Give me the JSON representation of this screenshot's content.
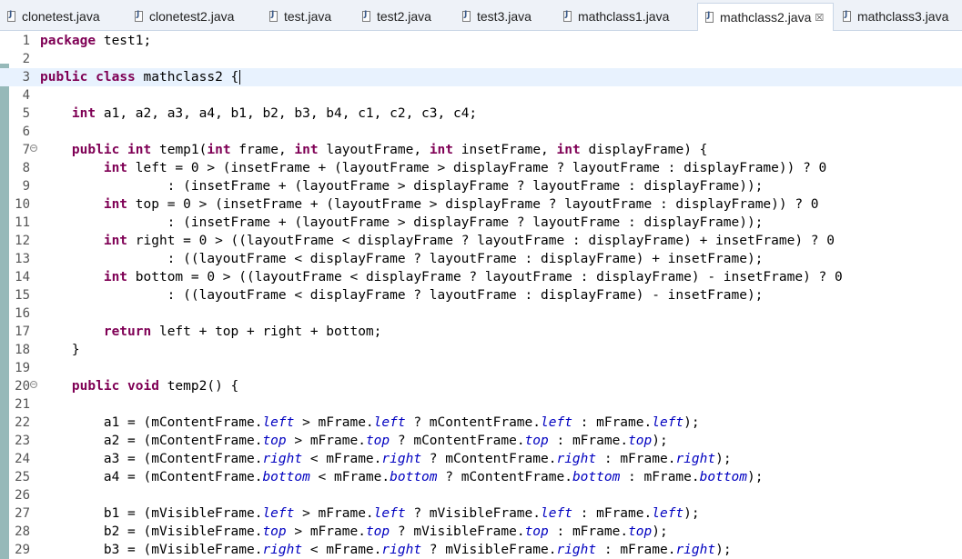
{
  "tabs": [
    {
      "label": "clonetest.java",
      "active": false
    },
    {
      "label": "clonetest2.java",
      "active": false
    },
    {
      "label": "test.java",
      "active": false
    },
    {
      "label": "test2.java",
      "active": false
    },
    {
      "label": "test3.java",
      "active": false
    },
    {
      "label": "mathclass1.java",
      "active": false
    },
    {
      "label": "mathclass2.java",
      "active": true,
      "close": "☒"
    },
    {
      "label": "mathclass3.java",
      "active": false
    }
  ],
  "editor": {
    "current_line": 3,
    "lines": [
      {
        "n": "1",
        "segs": [
          [
            "kw",
            "package"
          ],
          [
            "t",
            " test1;"
          ]
        ]
      },
      {
        "n": "2",
        "segs": []
      },
      {
        "n": "3",
        "segs": [
          [
            "kw",
            "public"
          ],
          [
            "t",
            " "
          ],
          [
            "kw",
            "class"
          ],
          [
            "t",
            " mathclass2 {"
          ]
        ]
      },
      {
        "n": "4",
        "segs": []
      },
      {
        "n": "5",
        "segs": [
          [
            "t",
            "    "
          ],
          [
            "kw",
            "int"
          ],
          [
            "t",
            " a1, a2, a3, a4, b1, b2, b3, b4, c1, c2, c3, c4;"
          ]
        ]
      },
      {
        "n": "6",
        "segs": []
      },
      {
        "n": "7",
        "fold": "⊖",
        "segs": [
          [
            "t",
            "    "
          ],
          [
            "kw",
            "public"
          ],
          [
            "t",
            " "
          ],
          [
            "kw",
            "int"
          ],
          [
            "t",
            " temp1("
          ],
          [
            "kw",
            "int"
          ],
          [
            "t",
            " frame, "
          ],
          [
            "kw",
            "int"
          ],
          [
            "t",
            " layoutFrame, "
          ],
          [
            "kw",
            "int"
          ],
          [
            "t",
            " insetFrame, "
          ],
          [
            "kw",
            "int"
          ],
          [
            "t",
            " displayFrame) {"
          ]
        ]
      },
      {
        "n": "8",
        "segs": [
          [
            "t",
            "        "
          ],
          [
            "kw",
            "int"
          ],
          [
            "t",
            " left = 0 > (insetFrame + (layoutFrame > displayFrame ? layoutFrame : displayFrame)) ? 0"
          ]
        ]
      },
      {
        "n": "9",
        "segs": [
          [
            "t",
            "                : (insetFrame + (layoutFrame > displayFrame ? layoutFrame : displayFrame));"
          ]
        ]
      },
      {
        "n": "10",
        "segs": [
          [
            "t",
            "        "
          ],
          [
            "kw",
            "int"
          ],
          [
            "t",
            " top = 0 > (insetFrame + (layoutFrame > displayFrame ? layoutFrame : displayFrame)) ? 0"
          ]
        ]
      },
      {
        "n": "11",
        "segs": [
          [
            "t",
            "                : (insetFrame + (layoutFrame > displayFrame ? layoutFrame : displayFrame));"
          ]
        ]
      },
      {
        "n": "12",
        "segs": [
          [
            "t",
            "        "
          ],
          [
            "kw",
            "int"
          ],
          [
            "t",
            " right = 0 > ((layoutFrame < displayFrame ? layoutFrame : displayFrame) + insetFrame) ? 0"
          ]
        ]
      },
      {
        "n": "13",
        "segs": [
          [
            "t",
            "                : ((layoutFrame < displayFrame ? layoutFrame : displayFrame) + insetFrame);"
          ]
        ]
      },
      {
        "n": "14",
        "segs": [
          [
            "t",
            "        "
          ],
          [
            "kw",
            "int"
          ],
          [
            "t",
            " bottom = 0 > ((layoutFrame < displayFrame ? layoutFrame : displayFrame) - insetFrame) ? 0"
          ]
        ]
      },
      {
        "n": "15",
        "segs": [
          [
            "t",
            "                : ((layoutFrame < displayFrame ? layoutFrame : displayFrame) - insetFrame);"
          ]
        ]
      },
      {
        "n": "16",
        "segs": []
      },
      {
        "n": "17",
        "segs": [
          [
            "t",
            "        "
          ],
          [
            "kw",
            "return"
          ],
          [
            "t",
            " left + top + right + bottom;"
          ]
        ]
      },
      {
        "n": "18",
        "segs": [
          [
            "t",
            "    }"
          ]
        ]
      },
      {
        "n": "19",
        "segs": []
      },
      {
        "n": "20",
        "fold": "⊖",
        "segs": [
          [
            "t",
            "    "
          ],
          [
            "kw",
            "public"
          ],
          [
            "t",
            " "
          ],
          [
            "kw",
            "void"
          ],
          [
            "t",
            " temp2() {"
          ]
        ]
      },
      {
        "n": "21",
        "segs": []
      },
      {
        "n": "22",
        "segs": [
          [
            "t",
            "        a1 = (mContentFrame."
          ],
          [
            "fld",
            "left"
          ],
          [
            "t",
            " > mFrame."
          ],
          [
            "fld",
            "left"
          ],
          [
            "t",
            " ? mContentFrame."
          ],
          [
            "fld",
            "left"
          ],
          [
            "t",
            " : mFrame."
          ],
          [
            "fld",
            "left"
          ],
          [
            "t",
            ");"
          ]
        ]
      },
      {
        "n": "23",
        "segs": [
          [
            "t",
            "        a2 = (mContentFrame."
          ],
          [
            "fld",
            "top"
          ],
          [
            "t",
            " > mFrame."
          ],
          [
            "fld",
            "top"
          ],
          [
            "t",
            " ? mContentFrame."
          ],
          [
            "fld",
            "top"
          ],
          [
            "t",
            " : mFrame."
          ],
          [
            "fld",
            "top"
          ],
          [
            "t",
            ");"
          ]
        ]
      },
      {
        "n": "24",
        "segs": [
          [
            "t",
            "        a3 = (mContentFrame."
          ],
          [
            "fld",
            "right"
          ],
          [
            "t",
            " < mFrame."
          ],
          [
            "fld",
            "right"
          ],
          [
            "t",
            " ? mContentFrame."
          ],
          [
            "fld",
            "right"
          ],
          [
            "t",
            " : mFrame."
          ],
          [
            "fld",
            "right"
          ],
          [
            "t",
            ");"
          ]
        ]
      },
      {
        "n": "25",
        "segs": [
          [
            "t",
            "        a4 = (mContentFrame."
          ],
          [
            "fld",
            "bottom"
          ],
          [
            "t",
            " < mFrame."
          ],
          [
            "fld",
            "bottom"
          ],
          [
            "t",
            " ? mContentFrame."
          ],
          [
            "fld",
            "bottom"
          ],
          [
            "t",
            " : mFrame."
          ],
          [
            "fld",
            "bottom"
          ],
          [
            "t",
            ");"
          ]
        ]
      },
      {
        "n": "26",
        "segs": []
      },
      {
        "n": "27",
        "segs": [
          [
            "t",
            "        b1 = (mVisibleFrame."
          ],
          [
            "fld",
            "left"
          ],
          [
            "t",
            " > mFrame."
          ],
          [
            "fld",
            "left"
          ],
          [
            "t",
            " ? mVisibleFrame."
          ],
          [
            "fld",
            "left"
          ],
          [
            "t",
            " : mFrame."
          ],
          [
            "fld",
            "left"
          ],
          [
            "t",
            ");"
          ]
        ]
      },
      {
        "n": "28",
        "segs": [
          [
            "t",
            "        b2 = (mVisibleFrame."
          ],
          [
            "fld",
            "top"
          ],
          [
            "t",
            " > mFrame."
          ],
          [
            "fld",
            "top"
          ],
          [
            "t",
            " ? mVisibleFrame."
          ],
          [
            "fld",
            "top"
          ],
          [
            "t",
            " : mFrame."
          ],
          [
            "fld",
            "top"
          ],
          [
            "t",
            ");"
          ]
        ]
      },
      {
        "n": "29",
        "segs": [
          [
            "t",
            "        b3 = (mVisibleFrame."
          ],
          [
            "fld",
            "right"
          ],
          [
            "t",
            " < mFrame."
          ],
          [
            "fld",
            "right"
          ],
          [
            "t",
            " ? mVisibleFrame."
          ],
          [
            "fld",
            "right"
          ],
          [
            "t",
            " : mFrame."
          ],
          [
            "fld",
            "right"
          ],
          [
            "t",
            ");"
          ]
        ]
      }
    ]
  },
  "colors": {
    "keyword": "#7f0055",
    "field": "#0000c0",
    "current_line": "#e8f2fe",
    "ruler": "#3f7f7f"
  }
}
